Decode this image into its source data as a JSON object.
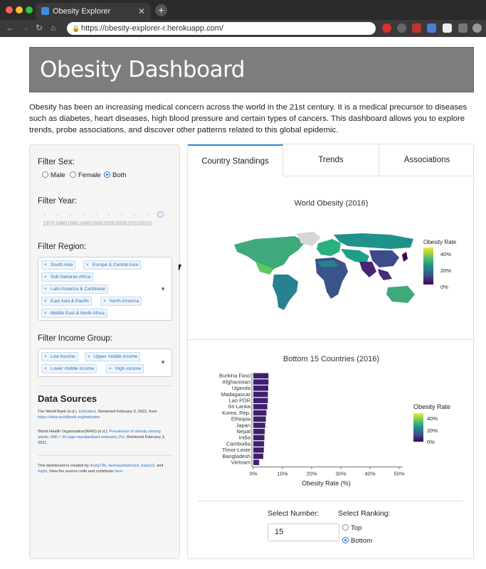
{
  "browser": {
    "tab_title": "Obesity Explorer",
    "url": "https://obesity-explorer-r.herokuapp.com/"
  },
  "header": {
    "title": "Obesity Dashboard"
  },
  "intro": "Obesity has been an increasing medical concern across the world in the 21st century. It is a medical precursor to diseases such as diabetes, heart diseases, high blood pressure and certain types of cancers. This dashboard allows you to explore trends, probe associations, and discover other patterns related to this global epidemic.",
  "sidebar": {
    "filter_sex_label": "Filter Sex:",
    "sex_options": [
      "Male",
      "Female",
      "Both"
    ],
    "sex_selected": "Both",
    "filter_year_label": "Filter Year:",
    "year_ticks": "1975198019851990199520002005201020",
    "year_ticks_tail": "15",
    "year_value": 2016,
    "filter_region_label": "Filter Region:",
    "regions": [
      "South Asia",
      "Europe & Central Asia",
      "Sub-Saharan Africa",
      "Latin America & Caribbean",
      "East Asia & Pacific",
      "North America",
      "Middle East & North Africa"
    ],
    "filter_income_label": "Filter Income Group:",
    "income_groups": [
      "Low income",
      "Upper middle income",
      "Lower middle income",
      "High income"
    ],
    "data_sources_title": "Data Sources",
    "ds1_pre": "The World Bank (n.d.). ",
    "ds1_link": "Indicators",
    "ds1_mid": ". Retrieved February 3, 2021, from ",
    "ds1_url": "https://data.worldbank.org/indicator",
    "ds1_end": ".",
    "ds2_pre": "World Health Organization(WHO) (n.d.). ",
    "ds2_link": "Prevalence of obesity among adults, BMI > 30 (age-standardized estimate) (%).",
    "ds2_end": " Retrieved February 3, 2021.",
    "credit_pre": "This dashboard is created by ",
    "credit_a1": "dusty736",
    "credit_a2": "tanmaysharma19",
    "credit_a3": "jraza19",
    "credit_and": ", and ",
    "credit_a4": "rtaph",
    "credit_mid": ". View the source code and contribute ",
    "credit_link": "here",
    "credit_end": "."
  },
  "tabs": [
    "Country Standings",
    "Trends",
    "Associations"
  ],
  "active_tab": "Country Standings",
  "map": {
    "title": "World Obesity (2016)",
    "legend_title": "Obesity Rate",
    "legend_ticks": [
      "40%",
      "20%",
      "0%"
    ]
  },
  "controls": {
    "select_number_label": "Select Number:",
    "select_number_value": "15",
    "select_ranking_label": "Select Ranking:",
    "ranking_options": [
      "Top",
      "Bottom"
    ],
    "ranking_selected": "Bottom"
  },
  "chart_data": {
    "type": "bar",
    "orientation": "horizontal",
    "title": "Bottom 15 Countries (2016)",
    "xlabel": "Obesity Rate (%)",
    "ylabel": "",
    "categories": [
      "Burkina Faso",
      "Afghanistan",
      "Uganda",
      "Madagascar",
      "Lao PDR",
      "Sri Lanka",
      "Korea, Rep.",
      "Ethiopia",
      "Japan",
      "Nepal",
      "India",
      "Cambodia",
      "Timor-Leste",
      "Bangladesh",
      "Vietnam"
    ],
    "values": [
      5.2,
      5.2,
      5.1,
      5.0,
      5.0,
      4.8,
      4.5,
      4.3,
      4.1,
      3.9,
      3.8,
      3.7,
      3.6,
      3.4,
      2.0
    ],
    "xlim": [
      0,
      50
    ],
    "x_ticks": [
      "0%",
      "10%",
      "20%",
      "30%",
      "40%",
      "50%"
    ],
    "legend_title": "Obesity Rate",
    "legend_ticks": [
      "40%",
      "20%",
      "0%"
    ],
    "bar_color": "#3f1f6e"
  }
}
